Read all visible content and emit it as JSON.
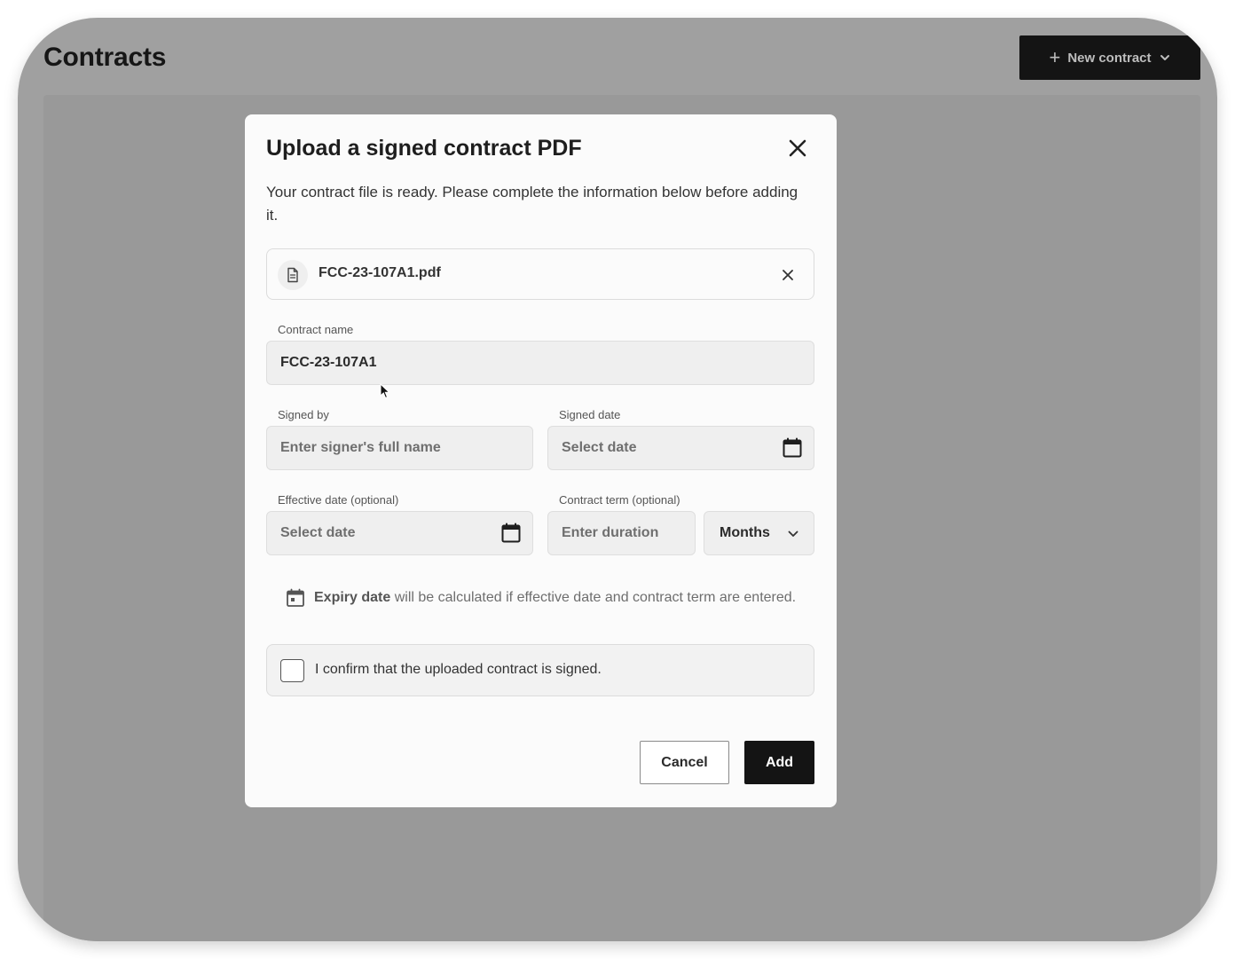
{
  "page": {
    "title": "Contracts",
    "new_contract_label": "New contract"
  },
  "modal": {
    "title": "Upload a signed contract PDF",
    "description": "Your contract file is ready. Please complete the information below before adding it.",
    "file": {
      "name": "FCC-23-107A1.pdf"
    },
    "contract_name": {
      "label": "Contract name",
      "value": "FCC-23-107A1"
    },
    "signed_by": {
      "label": "Signed by",
      "placeholder": "Enter signer's full name"
    },
    "signed_date": {
      "label": "Signed date",
      "placeholder": "Select date"
    },
    "effective_date": {
      "label": "Effective date (optional)",
      "placeholder": "Select date"
    },
    "contract_term": {
      "label": "Contract term (optional)",
      "placeholder": "Enter duration",
      "unit": "Months"
    },
    "expiry_note": {
      "bold": "Expiry date",
      "rest": "will be calculated if effective date and contract term are entered."
    },
    "confirm_label": "I confirm that the uploaded contract is signed.",
    "cancel_label": "Cancel",
    "add_label": "Add"
  },
  "colors": {
    "overlay": "#a0a0a0",
    "primary_button": "#141414",
    "modal_bg": "#fbfbfb"
  }
}
